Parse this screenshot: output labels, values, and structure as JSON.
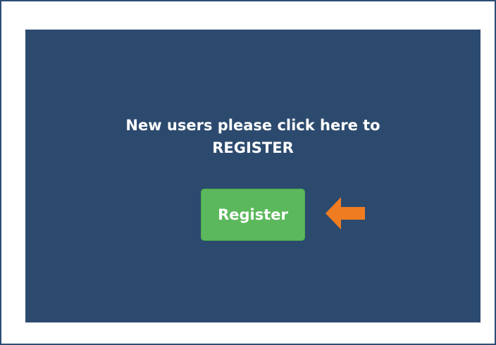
{
  "register_panel": {
    "message_line1": "New users please click here to",
    "message_line2": "REGISTER",
    "button_label": "Register"
  },
  "icons": {
    "pointer_arrow": "arrow-left-icon"
  },
  "colors": {
    "panel_background": "#2c4a6e",
    "button_background": "#5cb85c",
    "arrow": "#f07c22",
    "frame_border": "#2e4d73"
  }
}
